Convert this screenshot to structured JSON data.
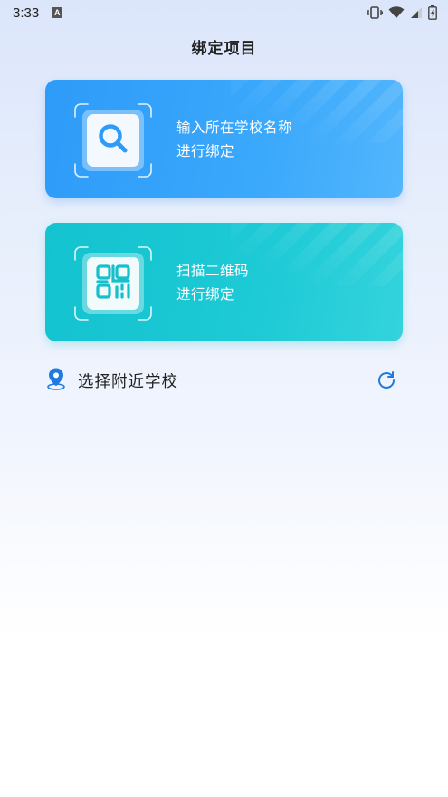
{
  "status_bar": {
    "time": "3:33",
    "app_icon_letter": "A",
    "icons": [
      "vibrate-icon",
      "wifi-icon",
      "signal-icon",
      "battery-icon"
    ]
  },
  "header": {
    "title": "绑定项目"
  },
  "cards": {
    "search": {
      "line1": "输入所在学校名称",
      "line2": "进行绑定",
      "icon": "search-icon",
      "color": "#3aa8fb"
    },
    "qr": {
      "line1": "扫描二维码",
      "line2": "进行绑定",
      "icon": "qr-code-icon",
      "color": "#1dcad6"
    }
  },
  "nearby": {
    "label": "选择附近学校",
    "icon": "location-pin-icon",
    "refresh_icon": "refresh-icon",
    "accent": "#1f7be0"
  }
}
